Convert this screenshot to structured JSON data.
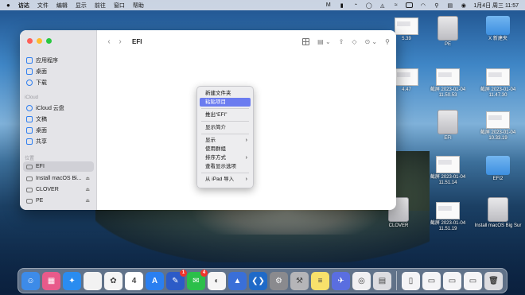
{
  "menubar": {
    "app_name": "访达",
    "menus": [
      "文件",
      "编辑",
      "显示",
      "前往",
      "窗口",
      "帮助"
    ],
    "datetime": "1月4日 周三 11:57"
  },
  "finder": {
    "title": "EFI",
    "sidebar": {
      "favorites": [
        {
          "label": "应用程序",
          "icon": "applications-icon"
        },
        {
          "label": "桌面",
          "icon": "desktop-icon"
        },
        {
          "label": "下载",
          "icon": "downloads-icon"
        }
      ],
      "icloud_header": "iCloud",
      "icloud": [
        {
          "label": "iCloud 云盘",
          "icon": "icloud-icon"
        },
        {
          "label": "文稿",
          "icon": "documents-icon"
        },
        {
          "label": "桌面",
          "icon": "desktop-icon"
        },
        {
          "label": "共享",
          "icon": "shared-icon"
        }
      ],
      "locations_header": "位置",
      "locations": [
        {
          "label": "EFI",
          "icon": "disk-icon",
          "active": true
        },
        {
          "label": "Install macOS Bi...",
          "icon": "disk-icon",
          "eject": true
        },
        {
          "label": "CLOVER",
          "icon": "disk-icon",
          "eject": true
        },
        {
          "label": "PE",
          "icon": "disk-icon",
          "eject": true
        }
      ]
    }
  },
  "context_menu": {
    "items": [
      {
        "label": "新建文件夹"
      },
      {
        "label": "粘贴项目",
        "highlighted": true
      },
      {
        "sep": true
      },
      {
        "label": "推出“EFI”"
      },
      {
        "sep": true
      },
      {
        "label": "显示简介"
      },
      {
        "sep": true
      },
      {
        "label": "显示",
        "submenu": true
      },
      {
        "label": "使用群组"
      },
      {
        "label": "排序方式",
        "submenu": true
      },
      {
        "label": "查看显示选项"
      },
      {
        "sep": true
      },
      {
        "label": "从 iPad 导入",
        "submenu": true
      }
    ]
  },
  "desktop": {
    "icons": [
      {
        "label": "PE",
        "kind": "drive"
      },
      {
        "label": "X 新建夹",
        "kind": "folder"
      },
      {
        "label": "截屏 2023-01-04 11.50.53",
        "kind": "screenshot"
      },
      {
        "label": "截屏 2023-01-04 11.47.30",
        "kind": "screenshot"
      },
      {
        "label": "EFI",
        "kind": "drive"
      },
      {
        "label": "截屏 2023-01-04 10.33.19",
        "kind": "screenshot"
      },
      {
        "label": "截屏 2023-01-04 11.51.14",
        "kind": "screenshot"
      },
      {
        "label": "EFI2",
        "kind": "folder"
      },
      {
        "label": "CLOVER",
        "kind": "drive"
      },
      {
        "label": "截屏 2023-01-04 11.51.19",
        "kind": "screenshot"
      },
      {
        "label": "Install macOS Big Sur",
        "kind": "drive"
      },
      {
        "label": "5.39",
        "kind": "screenshot"
      },
      {
        "label": "4.47",
        "kind": "screenshot"
      }
    ]
  },
  "dock": {
    "apps": [
      {
        "name": "finder-icon",
        "color": "#3d8be8",
        "glyph": "☺"
      },
      {
        "name": "launchpad-icon",
        "color": "#e85a8a",
        "glyph": "▦"
      },
      {
        "name": "safari-icon",
        "color": "#2a8cf0",
        "glyph": "✦"
      },
      {
        "name": "photos-booth-icon",
        "color": "#f2f2f2",
        "glyph": ""
      },
      {
        "name": "photos-icon",
        "color": "#f5f5f5",
        "glyph": "✿"
      },
      {
        "name": "calendar-icon",
        "color": "#ffffff",
        "glyph": "4"
      },
      {
        "name": "app-store-icon",
        "color": "#2a7ff0",
        "glyph": "A"
      },
      {
        "name": "xcode-icon",
        "color": "#2c5bc7",
        "glyph": "✎",
        "badge": "1"
      },
      {
        "name": "wechat-icon",
        "color": "#2bbf4a",
        "glyph": "✉",
        "badge": "4"
      },
      {
        "name": "qq-icon",
        "color": "#f5f5f5",
        "glyph": "◐"
      },
      {
        "name": "mountain-icon",
        "color": "#3a6fd8",
        "glyph": "▲"
      },
      {
        "name": "vscode-icon",
        "color": "#1f6ac8",
        "glyph": "❮❯"
      },
      {
        "name": "system-preferences-icon",
        "color": "#8a8a8e",
        "glyph": "⚙"
      },
      {
        "name": "disk-utility-icon",
        "color": "#b5b5b8",
        "glyph": "⚒"
      },
      {
        "name": "notes-icon",
        "color": "#f8e16b",
        "glyph": "≡"
      },
      {
        "name": "swift-icon",
        "color": "#5a6ee0",
        "glyph": "✈"
      },
      {
        "name": "preview-icon",
        "color": "#f0f0f2",
        "glyph": "◎"
      },
      {
        "name": "terminal-icon",
        "color": "#dcdce0",
        "glyph": "▤"
      }
    ],
    "extras": [
      {
        "name": "document-icon",
        "color": "#f4f4f6",
        "glyph": "▯"
      },
      {
        "name": "recent-screenshot-icon",
        "color": "#f4f4f6",
        "glyph": "▭"
      },
      {
        "name": "recent-item-icon",
        "color": "#f4f4f6",
        "glyph": "▭"
      },
      {
        "name": "recent-item-icon",
        "color": "#f4f4f6",
        "glyph": "▭"
      },
      {
        "name": "trash-icon",
        "color": "#dcdce0",
        "glyph": "🗑"
      }
    ]
  }
}
